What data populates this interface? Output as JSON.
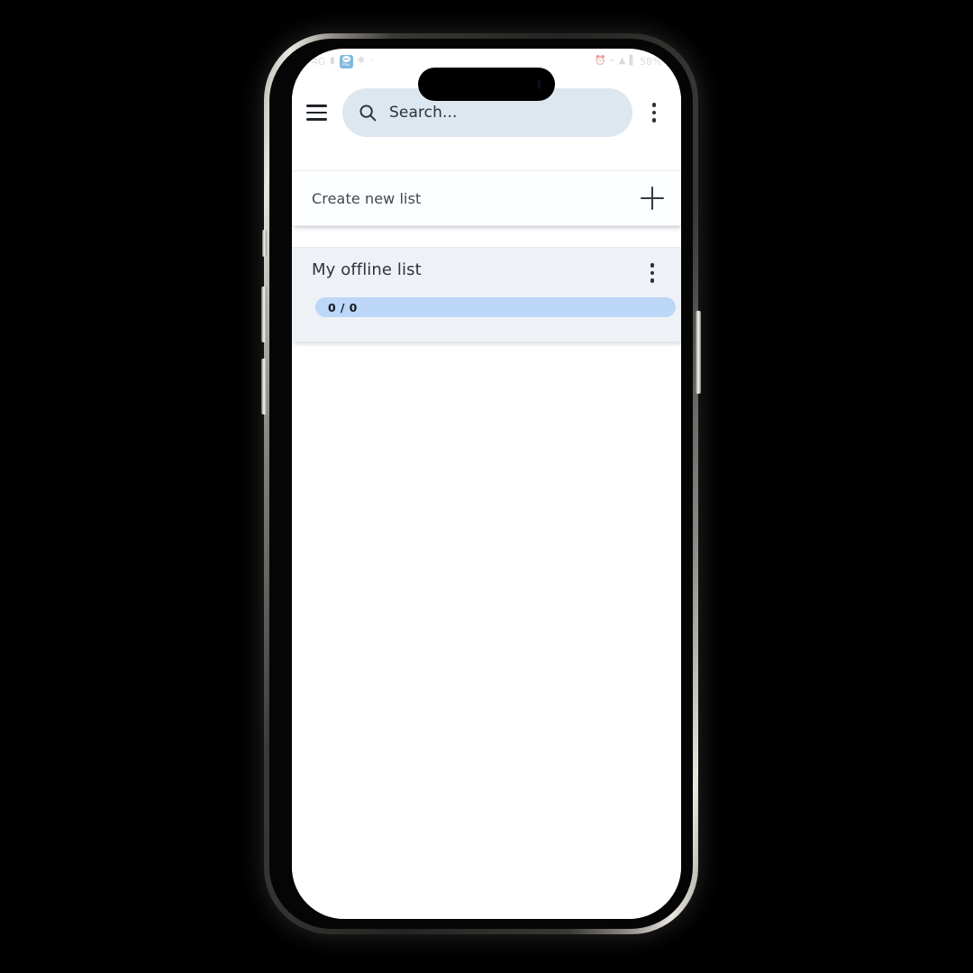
{
  "device": {
    "name": "smartphone-mockup",
    "frame_color": "#262422",
    "edge_color": "#d9d6d0",
    "screen_background": "#ffffff"
  },
  "status_bar": {
    "left_glyphs": [
      "4G",
      "signal-icon",
      "bluetooth-icon",
      "location-icon"
    ],
    "app_badge_label": "Plus",
    "right_glyphs": [
      "alarm-icon",
      "wifi-icon",
      "vibrate-icon",
      "signal-bars-icon"
    ],
    "battery_text": "58%"
  },
  "header": {
    "menu_icon": "hamburger-menu-icon",
    "search": {
      "icon": "search-icon",
      "value": "",
      "placeholder": "Search...",
      "background": "#dde7f0"
    },
    "overflow_icon": "more-vertical-icon"
  },
  "main": {
    "create_card": {
      "label": "Create new list",
      "action_icon": "plus-icon"
    },
    "lists": [
      {
        "title": "My offline list",
        "overflow_icon": "more-vertical-icon",
        "progress_text": "0 / 0",
        "completed": 0,
        "total": 0,
        "progress_color": "#bcd7f7",
        "card_color": "#eef2f7"
      }
    ]
  }
}
